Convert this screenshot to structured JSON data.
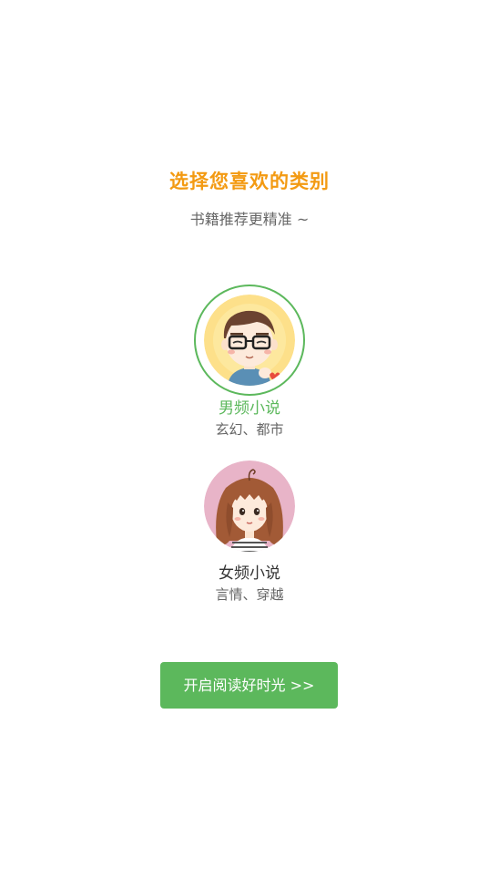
{
  "header": {
    "title": "选择您喜欢的类别",
    "subtitle": "书籍推荐更精准 ~"
  },
  "categories": [
    {
      "name": "男频小说",
      "description": "玄幻、都市",
      "selected": true,
      "avatar_icon": "boy-with-glasses-avatar"
    },
    {
      "name": "女频小说",
      "description": "言情、穿越",
      "selected": false,
      "avatar_icon": "girl-with-bangs-avatar"
    }
  ],
  "start_button": {
    "label": "开启阅读好时光 >>"
  },
  "colors": {
    "accent_orange": "#f39a12",
    "accent_green": "#5cb85c",
    "male_avatar_bg": "#fde08a",
    "female_avatar_bg": "#e8b4c8"
  }
}
